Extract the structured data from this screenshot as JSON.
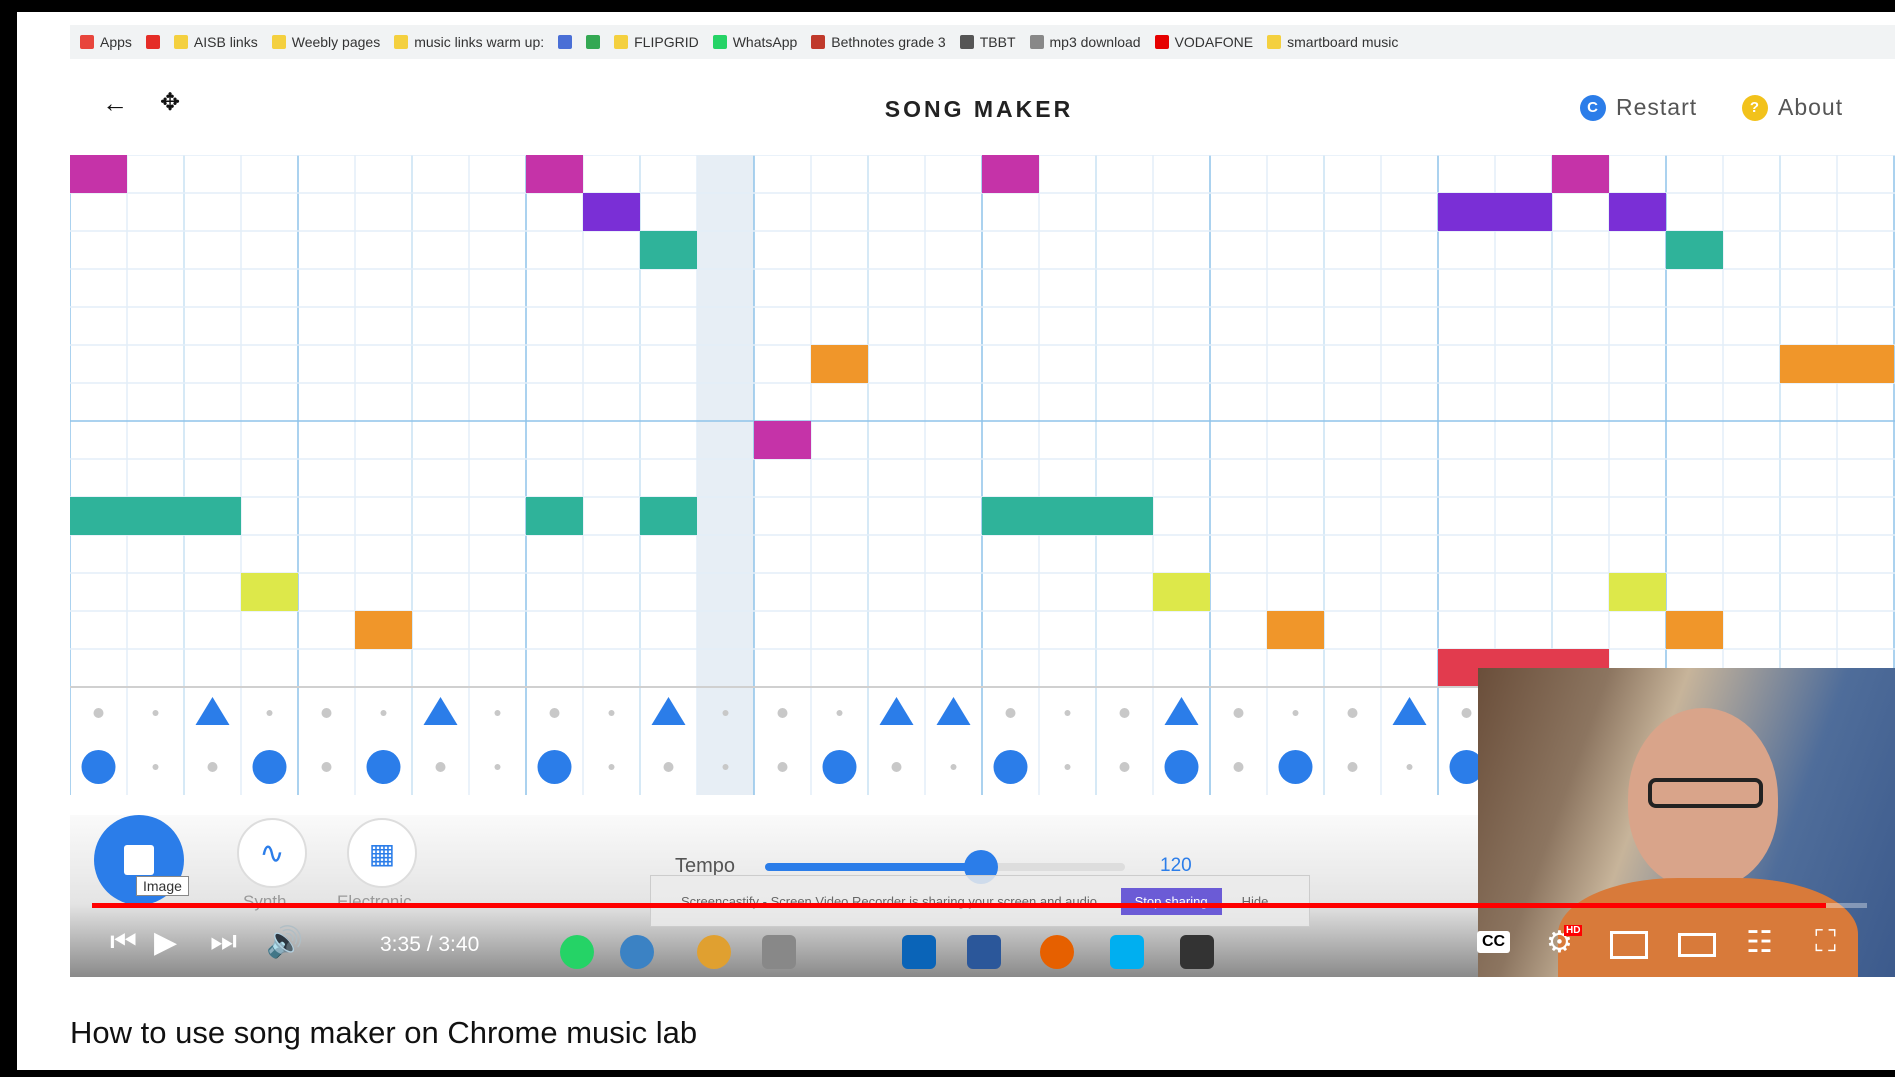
{
  "bookmarks": [
    {
      "label": "Apps",
      "icon": "apps-grid-icon",
      "color": "#e8453c"
    },
    {
      "label": "",
      "icon": "youtube-icon",
      "color": "#e52d27"
    },
    {
      "label": "AISB links",
      "icon": "folder-icon",
      "color": "#f4d03f"
    },
    {
      "label": "Weebly pages",
      "icon": "folder-icon",
      "color": "#f4d03f"
    },
    {
      "label": "music links warm up:",
      "icon": "folder-icon",
      "color": "#f4d03f"
    },
    {
      "label": "",
      "icon": "translate-icon",
      "color": "#4a6fd6"
    },
    {
      "label": "",
      "icon": "maps-icon",
      "color": "#34a853"
    },
    {
      "label": "FLIPGRID",
      "icon": "folder-icon",
      "color": "#f4d03f"
    },
    {
      "label": "WhatsApp",
      "icon": "whatsapp-icon",
      "color": "#25d366"
    },
    {
      "label": "Bethnotes grade 3",
      "icon": "bookmark-image-icon",
      "color": "#c0392b"
    },
    {
      "label": "TBBT",
      "icon": "bookmark-image-icon",
      "color": "#555555"
    },
    {
      "label": "mp3 download",
      "icon": "page-icon",
      "color": "#888888"
    },
    {
      "label": "VODAFONE",
      "icon": "vodafone-icon",
      "color": "#e60000"
    },
    {
      "label": "smartboard music",
      "icon": "folder-icon",
      "color": "#f4d03f"
    }
  ],
  "app": {
    "title": "SONG MAKER",
    "back_icon": "back-arrow-icon",
    "move_icon": "move-arrows-icon",
    "restart_label": "Restart",
    "about_label": "About",
    "about_glyph": "?",
    "restart_glyph": "C"
  },
  "melody_notes": [
    {
      "row": 0,
      "col": 0,
      "len": 1,
      "color": "#c533a8"
    },
    {
      "row": 0,
      "col": 8,
      "len": 1,
      "color": "#c533a8"
    },
    {
      "row": 0,
      "col": 16,
      "len": 1,
      "color": "#c533a8"
    },
    {
      "row": 0,
      "col": 26,
      "len": 1,
      "color": "#c533a8"
    },
    {
      "row": 1,
      "col": 9,
      "len": 1,
      "color": "#7a2fd6"
    },
    {
      "row": 1,
      "col": 24,
      "len": 2,
      "color": "#7a2fd6"
    },
    {
      "row": 1,
      "col": 27,
      "len": 1,
      "color": "#7a2fd6"
    },
    {
      "row": 2,
      "col": 10,
      "len": 1,
      "color": "#2fb39a"
    },
    {
      "row": 2,
      "col": 28,
      "len": 1,
      "color": "#2fb39a"
    },
    {
      "row": 5,
      "col": 13,
      "len": 1,
      "color": "#f0962a"
    },
    {
      "row": 5,
      "col": 30,
      "len": 2,
      "color": "#f0962a"
    },
    {
      "row": 7,
      "col": 12,
      "len": 1,
      "color": "#c533a8"
    },
    {
      "row": 9,
      "col": 0,
      "len": 3,
      "color": "#2fb39a"
    },
    {
      "row": 9,
      "col": 8,
      "len": 1,
      "color": "#2fb39a"
    },
    {
      "row": 9,
      "col": 10,
      "len": 1,
      "color": "#2fb39a"
    },
    {
      "row": 9,
      "col": 16,
      "len": 3,
      "color": "#2fb39a"
    },
    {
      "row": 11,
      "col": 3,
      "len": 1,
      "color": "#dde84a"
    },
    {
      "row": 11,
      "col": 19,
      "len": 1,
      "color": "#dde84a"
    },
    {
      "row": 11,
      "col": 27,
      "len": 1,
      "color": "#dde84a"
    },
    {
      "row": 12,
      "col": 5,
      "len": 1,
      "color": "#f0962a"
    },
    {
      "row": 12,
      "col": 21,
      "len": 1,
      "color": "#f0962a"
    },
    {
      "row": 12,
      "col": 28,
      "len": 1,
      "color": "#f0962a"
    },
    {
      "row": 13,
      "col": 24,
      "len": 3,
      "color": "#e23b4e"
    }
  ],
  "rhythm_triangles": [
    2,
    6,
    10,
    14,
    15,
    19,
    23
  ],
  "rhythm_circles": [
    0,
    3,
    5,
    8,
    13,
    16,
    19,
    21,
    24
  ],
  "playhead_col": 11,
  "controls": {
    "play_tooltip": "Image",
    "synth_label": "Synth",
    "electronic_label": "Electronic",
    "tempo_label": "Tempo",
    "tempo_value": "120",
    "tempo_fraction": 0.6,
    "accent": "#2b7de9"
  },
  "share_bar": {
    "text": "Screencastify - Screen Video Recorder is sharing your screen and audio.",
    "stop_label": "Stop sharing",
    "hide_label": "Hide"
  },
  "player": {
    "time": "3:35 / 3:40",
    "progress_fraction": 0.977,
    "cc_label": "CC",
    "hd_badge": "HD"
  },
  "video_title": "How to use song maker on Chrome music lab"
}
